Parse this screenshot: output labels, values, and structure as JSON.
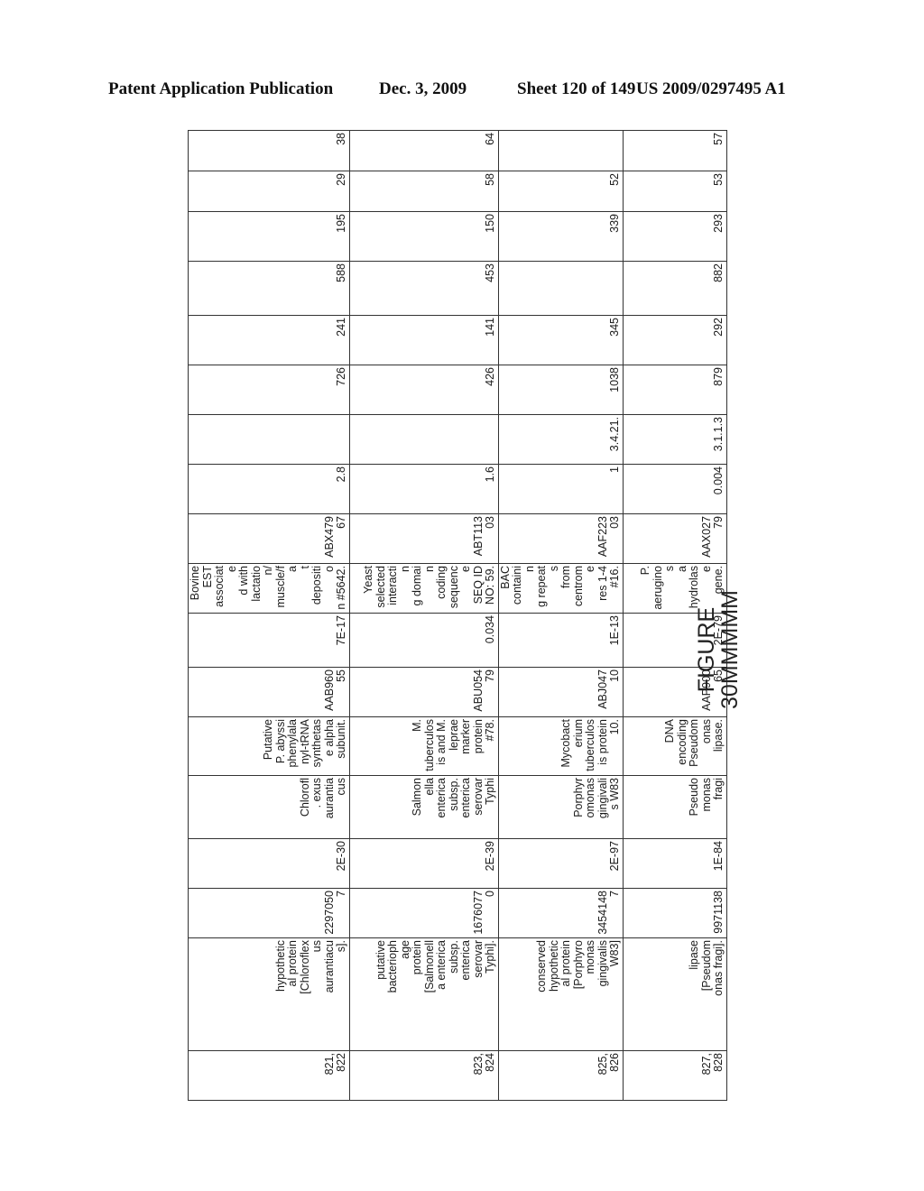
{
  "header": {
    "publication": "Patent Application Publication",
    "date": "Dec. 3, 2009",
    "sheet": "Sheet 120 of 149",
    "number": "US 2009/0297495 A1"
  },
  "table": {
    "rows": [
      [
        "821,\n822",
        "hypothetic\nal protein\n[Chloroflex\nus\naurantiacu\ns].",
        "22970507",
        "2E-30",
        "Chlorofl\n. exus\naurantia\ncus",
        "Putative\nP. abyssi\nphenylala\nnyl-tRNA\nsynthetas\ne alpha\nsubunit.",
        "AAB960\n55",
        "7E-17",
        "Bovine\nEST\nassociate\nd with\nlactation/\nmuscle/fa\nt\ndepositio\nn #5642.",
        "ABX479\n67",
        "2.8",
        "",
        "726",
        "241",
        "588",
        "195",
        "29",
        "38"
      ],
      [
        "823,\n824",
        "putative\nbacterioph\nage\nprotein\n[Salmonell\na enterica\nsubsp.\nenterica\nserovar\nTyphi].",
        "16760770",
        "2E-39",
        "Salmon\nella\nenterica\nsubsp.\nenterica\nserovar\nTyphi",
        "M.\ntuberculos\nis and M.\nleprae\nmarker\nprotein\n#78.",
        "ABU054\n79",
        "0.034",
        "Yeast\nselected\ninteractin\ng domain\ncoding\nsequence\nSEQ ID\nNO: 59.",
        "ABT113\n03",
        "1.6",
        "",
        "426",
        "141",
        "453",
        "150",
        "58",
        "64"
      ],
      [
        "825,\n826",
        "conserved\nhypothetic\nal protein\n[Porphyro\nmonas\ngingivalis\nW83]",
        "34541487",
        "2E-97",
        "Porphyr\nomonas\ngingivali\ns W83",
        "Mycobact\nerium\ntuberculos\nis protein\n10.",
        "ABJ047\n10",
        "1E-13",
        "BAC\ncontainin\ng repeats\nfrom\ncentrome\nres 1-4\n#16.",
        "AAF223\n03",
        "1",
        "3.4.21.",
        "1038",
        "345",
        "",
        "339",
        "52",
        ""
      ],
      [
        "827,\n828",
        "lipase\n[Pseudom\nonas fragi].",
        "9971138",
        "1E-84",
        "Pseudo\nmonas\nfragi",
        "DNA\nencoding\nPseudom\nonas\nlipase.",
        "AAP900\n65",
        "2E-79",
        "P.\naeruginos\na\nhydrolase\ngene.",
        "AAX027\n79",
        "0.004",
        "3.1.1.3",
        "879",
        "292",
        "882",
        "293",
        "53",
        "57"
      ]
    ]
  },
  "figure": {
    "line1": "FIGURE",
    "line2": "30MMMMM"
  }
}
